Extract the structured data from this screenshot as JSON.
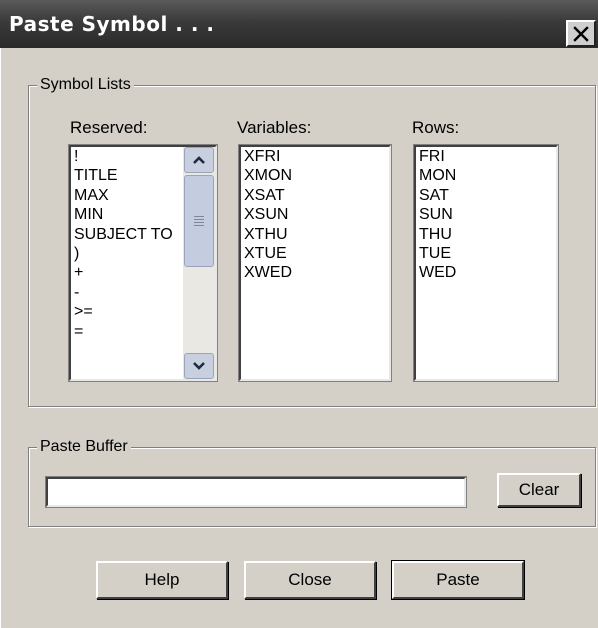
{
  "window": {
    "title": "Paste Symbol . . ."
  },
  "symbol_lists": {
    "group_label": "Symbol Lists",
    "reserved": {
      "label": "Reserved:",
      "items": [
        "!",
        "TITLE",
        "MAX",
        "MIN",
        "SUBJECT TO",
        ")",
        "+",
        "-",
        ">=",
        "="
      ]
    },
    "variables": {
      "label": "Variables:",
      "items": [
        "XFRI",
        "XMON",
        "XSAT",
        "XSUN",
        "XTHU",
        "XTUE",
        "XWED"
      ]
    },
    "rows": {
      "label": "Rows:",
      "items": [
        "FRI",
        "MON",
        "SAT",
        "SUN",
        "THU",
        "TUE",
        "WED"
      ]
    }
  },
  "paste_buffer": {
    "group_label": "Paste Buffer",
    "value": "",
    "clear_label": "Clear"
  },
  "buttons": {
    "help": "Help",
    "close": "Close",
    "paste": "Paste"
  },
  "icons": {
    "close": "close-icon",
    "scroll_up": "chevron-up-icon",
    "scroll_down": "chevron-down-icon",
    "scroll_grip": "grip-icon"
  }
}
